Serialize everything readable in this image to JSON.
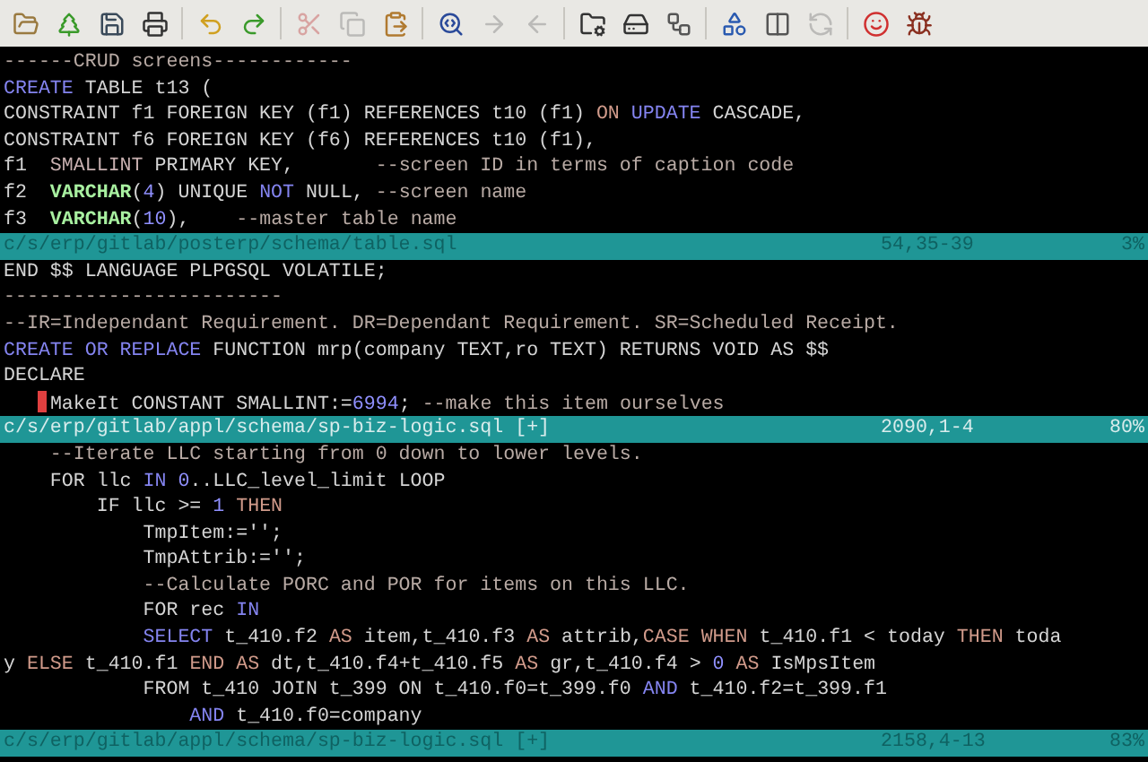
{
  "toolbar": [
    [
      {
        "disabled": false
      },
      {
        "disabled": false
      },
      {
        "disabled": false
      },
      {
        "disabled": false
      }
    ],
    [
      {
        "disabled": false
      },
      {
        "disabled": false
      }
    ],
    [
      {
        "disabled": true
      },
      {
        "disabled": true
      },
      {
        "disabled": false
      }
    ],
    [
      {
        "disabled": false
      },
      {
        "disabled": true
      },
      {
        "disabled": true
      }
    ],
    [
      {
        "disabled": false
      },
      {
        "disabled": false
      },
      {
        "disabled": false
      }
    ],
    [
      {
        "disabled": false
      },
      {
        "disabled": false
      },
      {
        "disabled": true
      }
    ],
    [
      {
        "disabled": false
      },
      {
        "disabled": false
      }
    ]
  ],
  "panes": [
    {
      "lines": [
        {
          "tokens": [
            {
              "kind": "comment",
              "text": "------CRUD screens------------"
            }
          ]
        },
        {
          "tokens": [
            {
              "kind": "keyword",
              "text": "CREATE"
            },
            {
              "kind": "plain",
              "text": " TABLE t13 ("
            }
          ]
        },
        {
          "tokens": [
            {
              "kind": "plain",
              "text": "CONSTRAINT f1 FOREIGN KEY (f1) REFERENCES t10 (f1) "
            },
            {
              "kind": "statement",
              "text": "ON "
            },
            {
              "kind": "keyword",
              "text": "UPDATE"
            },
            {
              "kind": "plain",
              "text": " CASCADE,"
            }
          ]
        },
        {
          "tokens": [
            {
              "kind": "plain",
              "text": "CONSTRAINT f6 FOREIGN KEY (f6) REFERENCES t10 (f1),"
            }
          ]
        },
        {
          "tokens": [
            {
              "kind": "plain",
              "text": "f1  "
            },
            {
              "kind": "type_alt",
              "text": "SMALLINT"
            },
            {
              "kind": "plain",
              "text": " PRIMARY KEY,       "
            },
            {
              "kind": "comment",
              "text": "--screen ID in terms of caption code"
            }
          ]
        },
        {
          "tokens": [
            {
              "kind": "plain",
              "text": "f2  "
            },
            {
              "kind": "type",
              "text": "VARCHAR"
            },
            {
              "kind": "plain",
              "text": "("
            },
            {
              "kind": "number",
              "text": "4"
            },
            {
              "kind": "plain",
              "text": ") UNIQUE "
            },
            {
              "kind": "keyword",
              "text": "NOT"
            },
            {
              "kind": "plain",
              "text": " NULL, "
            },
            {
              "kind": "comment",
              "text": "--screen name"
            }
          ]
        },
        {
          "tokens": [
            {
              "kind": "plain",
              "text": "f3  "
            },
            {
              "kind": "type",
              "text": "VARCHAR"
            },
            {
              "kind": "plain",
              "text": "("
            },
            {
              "kind": "number",
              "text": "10"
            },
            {
              "kind": "plain",
              "text": "),    "
            },
            {
              "kind": "comment",
              "text": "--master table name"
            }
          ]
        }
      ],
      "status": {
        "path": "c/s/erp/gitlab/posterp/schema/table.sql",
        "position": "54,35-39",
        "percent": "3%",
        "active": false
      }
    },
    {
      "lines": [
        {
          "tokens": [
            {
              "kind": "plain",
              "text": "END $$ LANGUAGE PLPGSQL VOLATILE;"
            }
          ]
        },
        {
          "tokens": [
            {
              "kind": "comment",
              "text": "------------------------"
            }
          ]
        },
        {
          "tokens": [
            {
              "kind": "comment",
              "text": "--IR=Independant Requirement. DR=Dependant Requirement. SR=Scheduled Receipt."
            }
          ]
        },
        {
          "tokens": [
            {
              "kind": "keyword",
              "text": "CREATE OR REPLACE"
            },
            {
              "kind": "plain",
              "text": " FUNCTION mrp(company TEXT,ro TEXT) RETURNS VOID AS $$"
            }
          ]
        },
        {
          "tokens": [
            {
              "kind": "plain",
              "text": "DECLARE"
            }
          ]
        },
        {
          "tokens": [
            {
              "kind": "plain",
              "text": "   MakeIt CONSTANT SMALLINT:=",
              "cursor": true
            },
            {
              "kind": "number",
              "text": "6994"
            },
            {
              "kind": "plain",
              "text": "; "
            },
            {
              "kind": "comment",
              "text": "--make this item ourselves"
            }
          ]
        }
      ],
      "status": {
        "path": "c/s/erp/gitlab/appl/schema/sp-biz-logic.sql [+]",
        "position": "2090,1-4",
        "percent": "80%",
        "active": true
      }
    },
    {
      "lines": [
        {
          "tokens": [
            {
              "kind": "comment",
              "text": "    --Iterate LLC starting from 0 down to lower levels."
            }
          ]
        },
        {
          "tokens": [
            {
              "kind": "plain",
              "text": "    FOR llc "
            },
            {
              "kind": "keyword",
              "text": "IN "
            },
            {
              "kind": "number",
              "text": "0"
            },
            {
              "kind": "plain",
              "text": "..LLC_level_limit LOOP"
            }
          ]
        },
        {
          "tokens": [
            {
              "kind": "plain",
              "text": "        IF llc >= "
            },
            {
              "kind": "number",
              "text": "1 "
            },
            {
              "kind": "statement",
              "text": "THEN"
            }
          ]
        },
        {
          "tokens": [
            {
              "kind": "plain",
              "text": "            TmpItem:='';"
            }
          ]
        },
        {
          "tokens": [
            {
              "kind": "plain",
              "text": "            TmpAttrib:='';"
            }
          ]
        },
        {
          "tokens": [
            {
              "kind": "comment",
              "text": "            --Calculate PORC and POR for items on this LLC."
            }
          ]
        },
        {
          "tokens": [
            {
              "kind": "plain",
              "text": "            FOR rec "
            },
            {
              "kind": "keyword",
              "text": "IN"
            }
          ]
        },
        {
          "tokens": [
            {
              "kind": "keyword",
              "text": "            SELECT"
            },
            {
              "kind": "plain",
              "text": " t_410.f2 "
            },
            {
              "kind": "statement",
              "text": "AS"
            },
            {
              "kind": "plain",
              "text": " item,t_410.f3 "
            },
            {
              "kind": "statement",
              "text": "AS"
            },
            {
              "kind": "plain",
              "text": " attrib,"
            },
            {
              "kind": "statement",
              "text": "CASE WHEN"
            },
            {
              "kind": "plain",
              "text": " t_410.f1 < today "
            },
            {
              "kind": "statement",
              "text": "THEN"
            },
            {
              "kind": "plain",
              "text": " toda"
            }
          ]
        },
        {
          "tokens": [
            {
              "kind": "plain",
              "text": "y "
            },
            {
              "kind": "statement",
              "text": "ELSE"
            },
            {
              "kind": "plain",
              "text": " t_410.f1 "
            },
            {
              "kind": "statement",
              "text": "END AS"
            },
            {
              "kind": "plain",
              "text": " dt,t_410.f4+t_410.f5 "
            },
            {
              "kind": "statement",
              "text": "AS"
            },
            {
              "kind": "plain",
              "text": " gr,t_410.f4 > "
            },
            {
              "kind": "number",
              "text": "0 "
            },
            {
              "kind": "statement",
              "text": "AS"
            },
            {
              "kind": "plain",
              "text": " IsMpsItem"
            }
          ]
        },
        {
          "tokens": [
            {
              "kind": "plain",
              "text": "            FROM t_410 JOIN t_399 ON t_410.f0=t_399.f0 "
            },
            {
              "kind": "keyword",
              "text": "AND"
            },
            {
              "kind": "plain",
              "text": " t_410.f2=t_399.f1"
            }
          ]
        },
        {
          "tokens": [
            {
              "kind": "keyword",
              "text": "                AND"
            },
            {
              "kind": "plain",
              "text": " t_410.f0=company"
            }
          ]
        }
      ],
      "status": {
        "path": "c/s/erp/gitlab/appl/schema/sp-biz-logic.sql [+]",
        "position": "2158,4-13",
        "percent": "83%",
        "active": false
      }
    }
  ]
}
